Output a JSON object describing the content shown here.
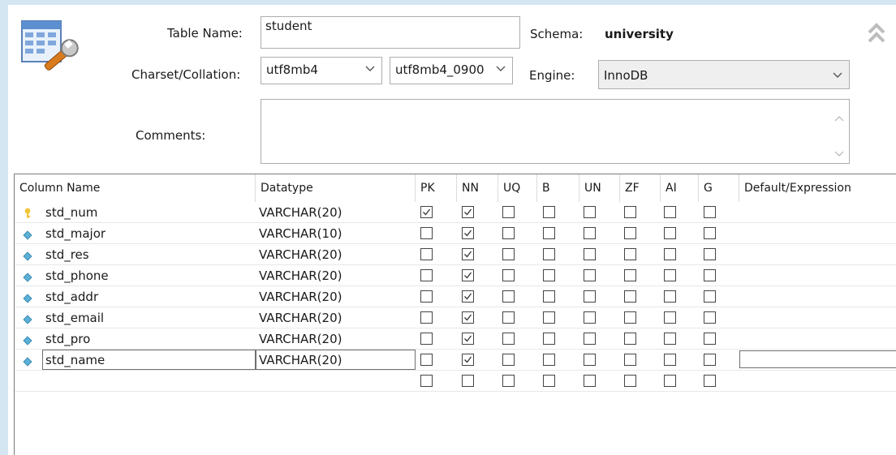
{
  "form": {
    "table_name_label": "Table Name:",
    "table_name_value": "student",
    "schema_label": "Schema:",
    "schema_value": "university",
    "charset_label": "Charset/Collation:",
    "charset_value": "utf8mb4",
    "collation_value": "utf8mb4_0900",
    "engine_label": "Engine:",
    "engine_value": "InnoDB",
    "comments_label": "Comments:",
    "comments_value": ""
  },
  "grid": {
    "headers": {
      "column_name": "Column Name",
      "datatype": "Datatype",
      "pk": "PK",
      "nn": "NN",
      "uq": "UQ",
      "b": "B",
      "un": "UN",
      "zf": "ZF",
      "ai": "AI",
      "g": "G",
      "default": "Default/Expression"
    },
    "rows": [
      {
        "name": "std_num",
        "type": "VARCHAR(20)",
        "key": true,
        "flags": [
          true,
          true,
          false,
          false,
          false,
          false,
          false,
          false
        ]
      },
      {
        "name": "std_major",
        "type": "VARCHAR(10)",
        "key": false,
        "flags": [
          false,
          true,
          false,
          false,
          false,
          false,
          false,
          false
        ]
      },
      {
        "name": "std_res",
        "type": "VARCHAR(20)",
        "key": false,
        "flags": [
          false,
          true,
          false,
          false,
          false,
          false,
          false,
          false
        ]
      },
      {
        "name": "std_phone",
        "type": "VARCHAR(20)",
        "key": false,
        "flags": [
          false,
          true,
          false,
          false,
          false,
          false,
          false,
          false
        ]
      },
      {
        "name": "std_addr",
        "type": "VARCHAR(20)",
        "key": false,
        "flags": [
          false,
          true,
          false,
          false,
          false,
          false,
          false,
          false
        ]
      },
      {
        "name": "std_email",
        "type": "VARCHAR(20)",
        "key": false,
        "flags": [
          false,
          true,
          false,
          false,
          false,
          false,
          false,
          false
        ]
      },
      {
        "name": "std_pro",
        "type": "VARCHAR(20)",
        "key": false,
        "flags": [
          false,
          true,
          false,
          false,
          false,
          false,
          false,
          false
        ]
      },
      {
        "name": "std_name",
        "type": "VARCHAR(20)",
        "key": false,
        "flags": [
          false,
          true,
          false,
          false,
          false,
          false,
          false,
          false
        ]
      }
    ]
  },
  "colors": {
    "key_icon": "#f0c53a",
    "column_icon": "#5ab0d6",
    "frame": "#d3e6f2"
  }
}
